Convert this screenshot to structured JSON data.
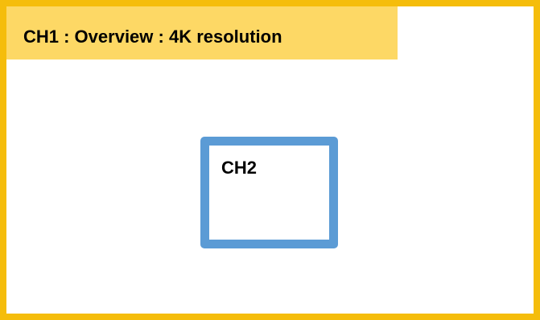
{
  "ch1": {
    "label": "CH1 : Overview : 4K resolution",
    "border_color": "#f5bd0b",
    "label_background": "#fdd865"
  },
  "ch2": {
    "label": "CH2",
    "border_color": "#5b9bd5"
  }
}
